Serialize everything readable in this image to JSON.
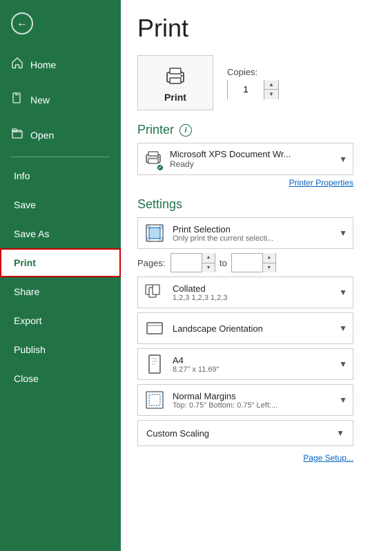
{
  "sidebar": {
    "back_label": "Back",
    "items": [
      {
        "id": "home",
        "label": "Home",
        "icon": "home"
      },
      {
        "id": "new",
        "label": "New",
        "icon": "new"
      },
      {
        "id": "open",
        "label": "Open",
        "icon": "open"
      }
    ],
    "text_items": [
      {
        "id": "info",
        "label": "Info",
        "active": false
      },
      {
        "id": "save",
        "label": "Save",
        "active": false
      },
      {
        "id": "saveas",
        "label": "Save As",
        "active": false
      },
      {
        "id": "print",
        "label": "Print",
        "active": true
      },
      {
        "id": "share",
        "label": "Share",
        "active": false
      },
      {
        "id": "export",
        "label": "Export",
        "active": false
      },
      {
        "id": "publish",
        "label": "Publish",
        "active": false
      },
      {
        "id": "close",
        "label": "Close",
        "active": false
      }
    ]
  },
  "main": {
    "title": "Print",
    "print_button_label": "Print",
    "copies_label": "Copies:",
    "copies_value": "1",
    "printer_section": {
      "title": "Printer",
      "printer_name": "Microsoft XPS Document Wr...",
      "printer_status": "Ready",
      "properties_link": "Printer Properties"
    },
    "settings_section": {
      "title": "Settings",
      "print_what_main": "Print Selection",
      "print_what_sub": "Only print the current selecti...",
      "pages_label": "Pages:",
      "pages_to": "to",
      "collated_main": "Collated",
      "collated_sub": "1,2,3    1,2,3    1,2,3",
      "orientation_main": "Landscape Orientation",
      "orientation_sub": "",
      "paper_main": "A4",
      "paper_sub": "8.27\" x 11.69\"",
      "margins_main": "Normal Margins",
      "margins_sub": "Top: 0.75\" Bottom: 0.75\" Left:...",
      "scaling_main": "Custom Scaling"
    },
    "page_setup_link": "Page Setup..."
  }
}
